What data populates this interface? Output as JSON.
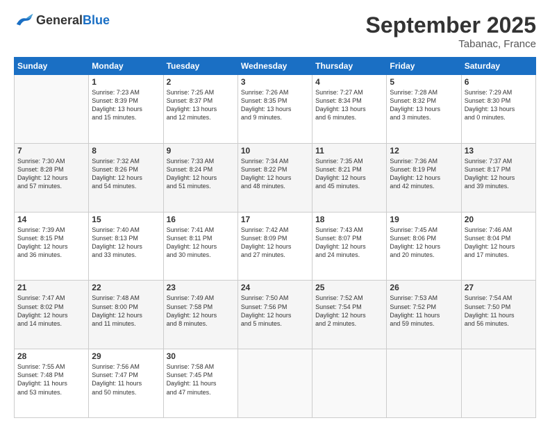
{
  "header": {
    "logo_general": "General",
    "logo_blue": "Blue",
    "month": "September 2025",
    "location": "Tabanac, France"
  },
  "weekdays": [
    "Sunday",
    "Monday",
    "Tuesday",
    "Wednesday",
    "Thursday",
    "Friday",
    "Saturday"
  ],
  "weeks": [
    [
      {
        "day": "",
        "content": ""
      },
      {
        "day": "1",
        "content": "Sunrise: 7:23 AM\nSunset: 8:39 PM\nDaylight: 13 hours\nand 15 minutes."
      },
      {
        "day": "2",
        "content": "Sunrise: 7:25 AM\nSunset: 8:37 PM\nDaylight: 13 hours\nand 12 minutes."
      },
      {
        "day": "3",
        "content": "Sunrise: 7:26 AM\nSunset: 8:35 PM\nDaylight: 13 hours\nand 9 minutes."
      },
      {
        "day": "4",
        "content": "Sunrise: 7:27 AM\nSunset: 8:34 PM\nDaylight: 13 hours\nand 6 minutes."
      },
      {
        "day": "5",
        "content": "Sunrise: 7:28 AM\nSunset: 8:32 PM\nDaylight: 13 hours\nand 3 minutes."
      },
      {
        "day": "6",
        "content": "Sunrise: 7:29 AM\nSunset: 8:30 PM\nDaylight: 13 hours\nand 0 minutes."
      }
    ],
    [
      {
        "day": "7",
        "content": "Sunrise: 7:30 AM\nSunset: 8:28 PM\nDaylight: 12 hours\nand 57 minutes."
      },
      {
        "day": "8",
        "content": "Sunrise: 7:32 AM\nSunset: 8:26 PM\nDaylight: 12 hours\nand 54 minutes."
      },
      {
        "day": "9",
        "content": "Sunrise: 7:33 AM\nSunset: 8:24 PM\nDaylight: 12 hours\nand 51 minutes."
      },
      {
        "day": "10",
        "content": "Sunrise: 7:34 AM\nSunset: 8:22 PM\nDaylight: 12 hours\nand 48 minutes."
      },
      {
        "day": "11",
        "content": "Sunrise: 7:35 AM\nSunset: 8:21 PM\nDaylight: 12 hours\nand 45 minutes."
      },
      {
        "day": "12",
        "content": "Sunrise: 7:36 AM\nSunset: 8:19 PM\nDaylight: 12 hours\nand 42 minutes."
      },
      {
        "day": "13",
        "content": "Sunrise: 7:37 AM\nSunset: 8:17 PM\nDaylight: 12 hours\nand 39 minutes."
      }
    ],
    [
      {
        "day": "14",
        "content": "Sunrise: 7:39 AM\nSunset: 8:15 PM\nDaylight: 12 hours\nand 36 minutes."
      },
      {
        "day": "15",
        "content": "Sunrise: 7:40 AM\nSunset: 8:13 PM\nDaylight: 12 hours\nand 33 minutes."
      },
      {
        "day": "16",
        "content": "Sunrise: 7:41 AM\nSunset: 8:11 PM\nDaylight: 12 hours\nand 30 minutes."
      },
      {
        "day": "17",
        "content": "Sunrise: 7:42 AM\nSunset: 8:09 PM\nDaylight: 12 hours\nand 27 minutes."
      },
      {
        "day": "18",
        "content": "Sunrise: 7:43 AM\nSunset: 8:07 PM\nDaylight: 12 hours\nand 24 minutes."
      },
      {
        "day": "19",
        "content": "Sunrise: 7:45 AM\nSunset: 8:06 PM\nDaylight: 12 hours\nand 20 minutes."
      },
      {
        "day": "20",
        "content": "Sunrise: 7:46 AM\nSunset: 8:04 PM\nDaylight: 12 hours\nand 17 minutes."
      }
    ],
    [
      {
        "day": "21",
        "content": "Sunrise: 7:47 AM\nSunset: 8:02 PM\nDaylight: 12 hours\nand 14 minutes."
      },
      {
        "day": "22",
        "content": "Sunrise: 7:48 AM\nSunset: 8:00 PM\nDaylight: 12 hours\nand 11 minutes."
      },
      {
        "day": "23",
        "content": "Sunrise: 7:49 AM\nSunset: 7:58 PM\nDaylight: 12 hours\nand 8 minutes."
      },
      {
        "day": "24",
        "content": "Sunrise: 7:50 AM\nSunset: 7:56 PM\nDaylight: 12 hours\nand 5 minutes."
      },
      {
        "day": "25",
        "content": "Sunrise: 7:52 AM\nSunset: 7:54 PM\nDaylight: 12 hours\nand 2 minutes."
      },
      {
        "day": "26",
        "content": "Sunrise: 7:53 AM\nSunset: 7:52 PM\nDaylight: 11 hours\nand 59 minutes."
      },
      {
        "day": "27",
        "content": "Sunrise: 7:54 AM\nSunset: 7:50 PM\nDaylight: 11 hours\nand 56 minutes."
      }
    ],
    [
      {
        "day": "28",
        "content": "Sunrise: 7:55 AM\nSunset: 7:48 PM\nDaylight: 11 hours\nand 53 minutes."
      },
      {
        "day": "29",
        "content": "Sunrise: 7:56 AM\nSunset: 7:47 PM\nDaylight: 11 hours\nand 50 minutes."
      },
      {
        "day": "30",
        "content": "Sunrise: 7:58 AM\nSunset: 7:45 PM\nDaylight: 11 hours\nand 47 minutes."
      },
      {
        "day": "",
        "content": ""
      },
      {
        "day": "",
        "content": ""
      },
      {
        "day": "",
        "content": ""
      },
      {
        "day": "",
        "content": ""
      }
    ]
  ]
}
